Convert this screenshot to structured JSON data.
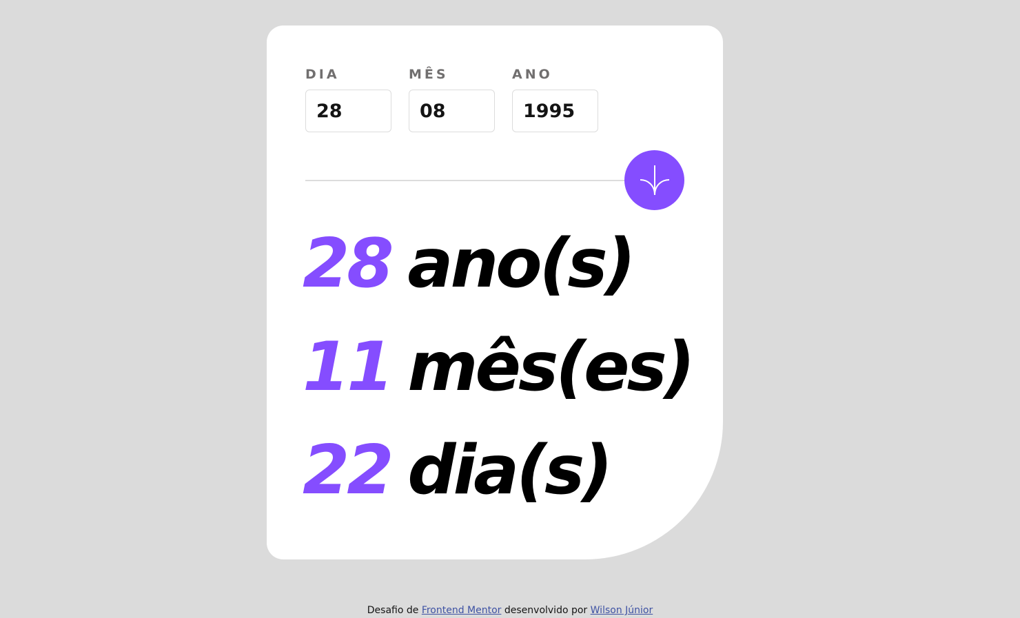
{
  "form": {
    "day": {
      "label": "DIA",
      "value": "28"
    },
    "month": {
      "label": "MÊS",
      "value": "08"
    },
    "year": {
      "label": "ANO",
      "value": "1995"
    },
    "submit_icon": "arrow-down-icon"
  },
  "results": {
    "years": {
      "value": "28",
      "unit": "ano(s)"
    },
    "months": {
      "value": "11",
      "unit": "mês(es)"
    },
    "days": {
      "value": "22",
      "unit": "dia(s)"
    }
  },
  "footer": {
    "prefix": "Desafio de",
    "challenge_link": "Frontend Mentor",
    "middle": "desenvolvido por",
    "author_link": "Wilson Júnior"
  },
  "colors": {
    "accent": "#854dff",
    "background": "#dbdbdb",
    "card": "#ffffff",
    "label": "#716f6f",
    "link": "#3e52a3"
  }
}
